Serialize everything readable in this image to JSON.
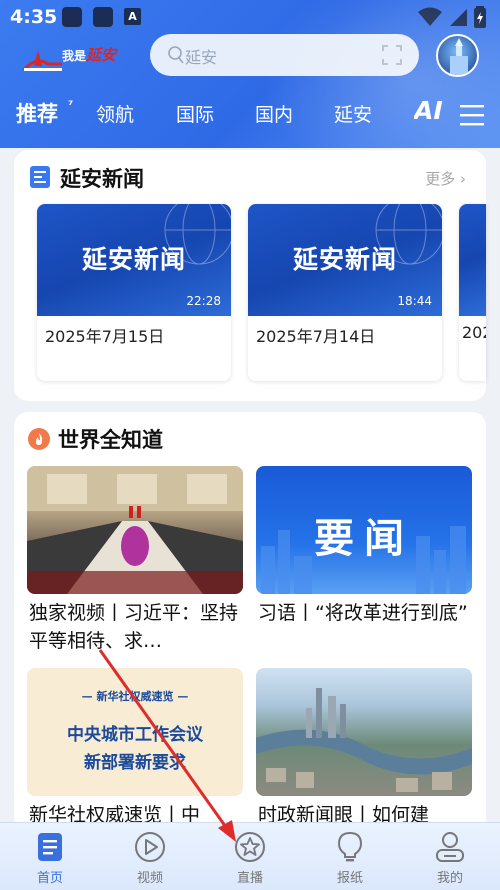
{
  "status_bar": {
    "time": "4:35",
    "notification_icon": "A"
  },
  "header": {
    "logo_text_a": "我是",
    "logo_text_b": "延安",
    "search_placeholder": "延安"
  },
  "tabs": [
    {
      "label": "推荐"
    },
    {
      "label": "领航"
    },
    {
      "label": "国际"
    },
    {
      "label": "国内"
    },
    {
      "label": "延安"
    },
    {
      "label": "AI"
    }
  ],
  "section1": {
    "title": "延安新闻",
    "more": "更多",
    "items": [
      {
        "thumb_title": "延安新闻",
        "duration": "22:28",
        "date": "2025年7月15日"
      },
      {
        "thumb_title": "延安新闻",
        "duration": "18:44",
        "date": "2025年7月14日"
      },
      {
        "thumb_title": "",
        "duration": "",
        "date": "202"
      }
    ]
  },
  "section2": {
    "title": "世界全知道",
    "items": [
      {
        "caption": "独家视频丨习近平：坚持平等相待、求…",
        "image": "meeting"
      },
      {
        "caption": "习语丨“将改革进行到底”",
        "image_text": "要闻"
      },
      {
        "caption": "新华社权威速览丨中",
        "image_top": "新华社权威速览",
        "image_line1": "中央城市工作会议",
        "image_line2": "新部署新要求"
      },
      {
        "caption": "时政新闻眼丨如何建",
        "image": "city-aerial"
      }
    ]
  },
  "bottom_nav": [
    {
      "label": "首页",
      "icon": "home-doc-icon",
      "active": true
    },
    {
      "label": "视频",
      "icon": "play-icon",
      "active": false
    },
    {
      "label": "直播",
      "icon": "star-icon",
      "active": false
    },
    {
      "label": "报纸",
      "icon": "bulb-icon",
      "active": false
    },
    {
      "label": "我的",
      "icon": "user-icon",
      "active": false
    }
  ],
  "colors": {
    "brand": "#3a6fe0",
    "header": "#2f6ae6",
    "accent_red": "#e02b2b"
  }
}
